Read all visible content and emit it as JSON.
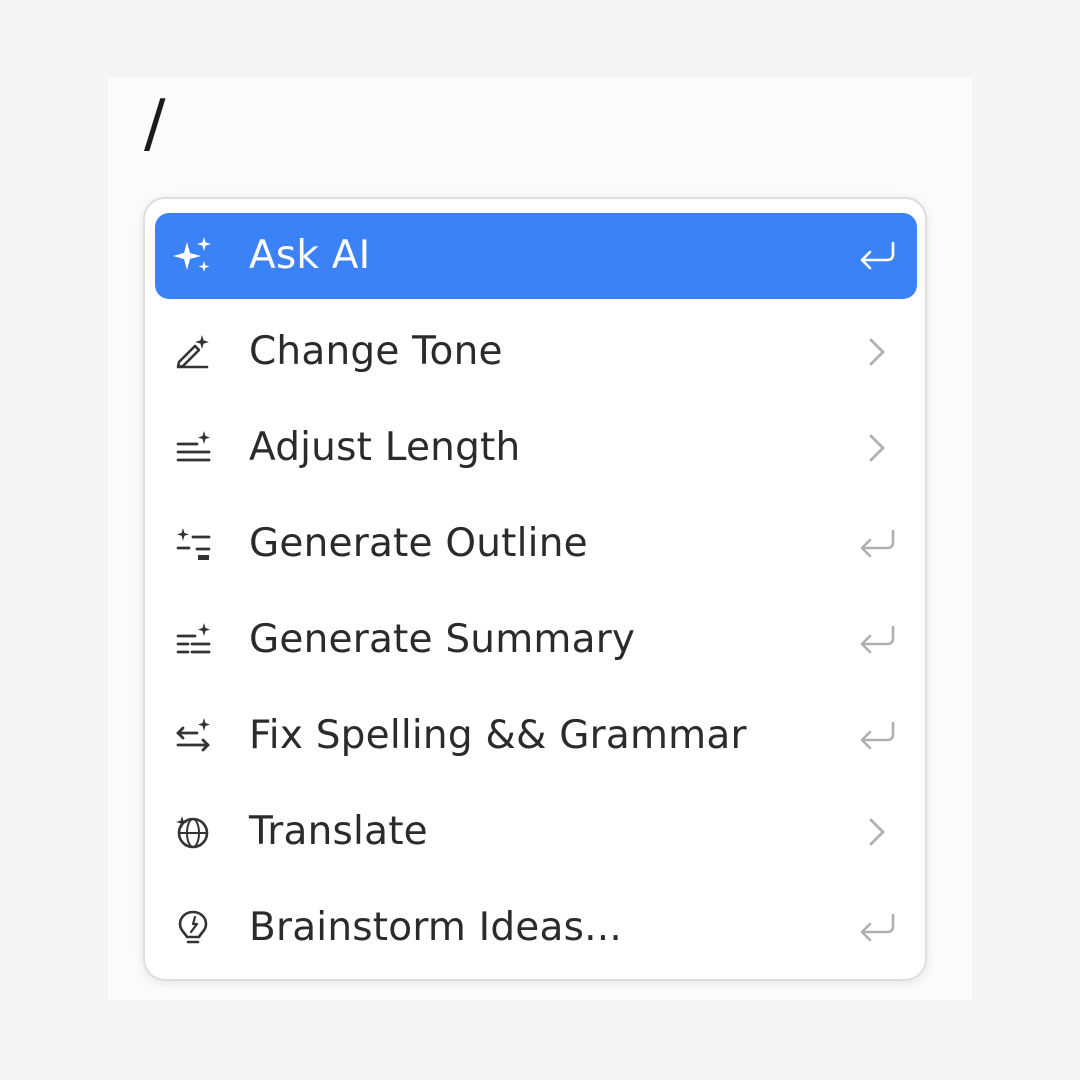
{
  "editor": {
    "slash": "/"
  },
  "menu": {
    "accent_color": "#3b82f6",
    "items": [
      {
        "label": "Ask AI",
        "icon": "sparkles-icon",
        "trail": "enter-icon",
        "active": true
      },
      {
        "label": "Change Tone",
        "icon": "pen-sparkle-icon",
        "trail": "chevron-right-icon",
        "active": false
      },
      {
        "label": "Adjust Length",
        "icon": "lines-sparkle-icon",
        "trail": "chevron-right-icon",
        "active": false
      },
      {
        "label": "Generate Outline",
        "icon": "outline-sparkle-icon",
        "trail": "enter-icon",
        "active": false
      },
      {
        "label": "Generate Summary",
        "icon": "summary-sparkle-icon",
        "trail": "enter-icon",
        "active": false
      },
      {
        "label": "Fix Spelling && Grammar",
        "icon": "swap-sparkle-icon",
        "trail": "enter-icon",
        "active": false
      },
      {
        "label": "Translate",
        "icon": "translate-icon",
        "trail": "chevron-right-icon",
        "active": false
      },
      {
        "label": "Brainstorm Ideas...",
        "icon": "lightbulb-icon",
        "trail": "enter-icon",
        "active": false
      }
    ]
  }
}
